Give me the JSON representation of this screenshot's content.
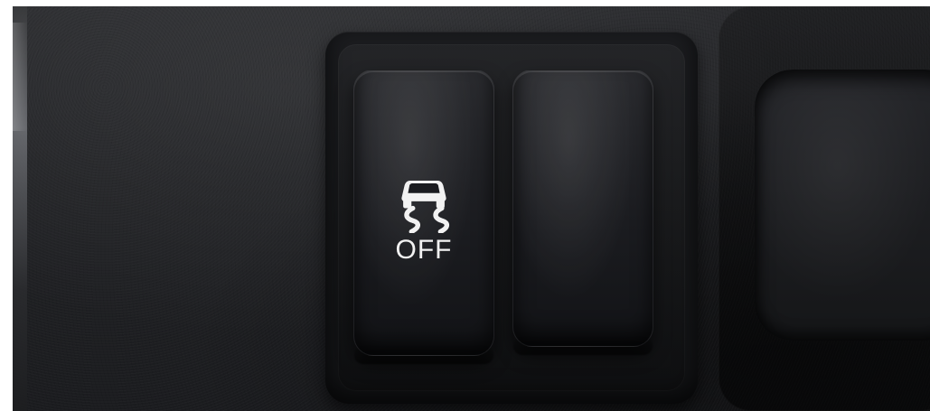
{
  "scene": {
    "switches": [
      {
        "id": "traction-control",
        "label": "OFF",
        "icon": "traction-control-off-icon"
      },
      {
        "id": "blank",
        "label": ""
      }
    ],
    "colors": {
      "panel": "#1f2023",
      "switch": "#1b1c20",
      "symbol": "#f2f2f2"
    }
  }
}
